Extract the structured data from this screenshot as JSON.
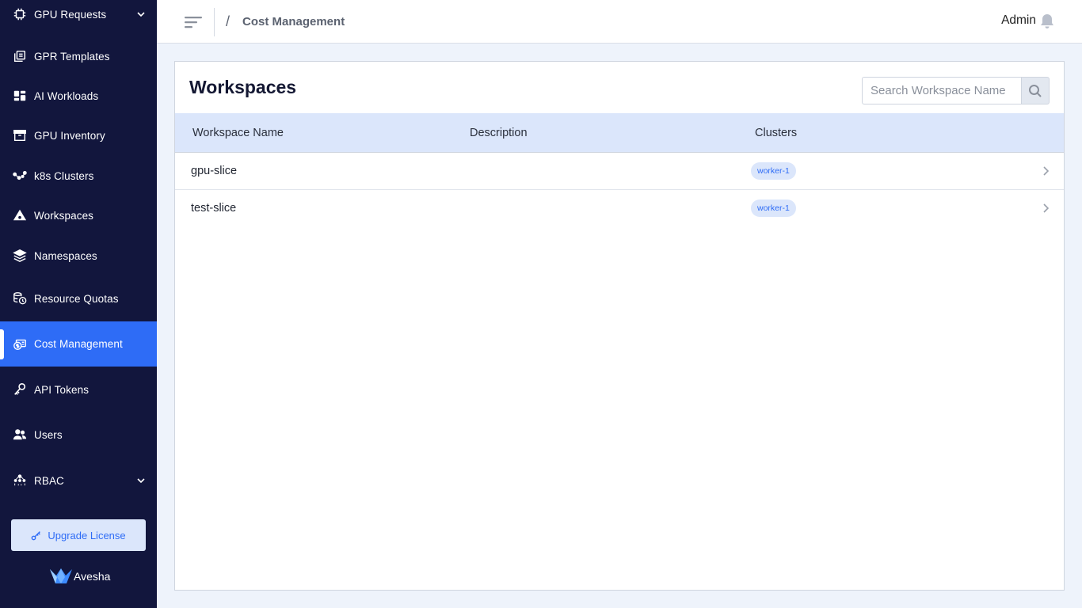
{
  "sidebar": {
    "items": [
      {
        "label": "GPU Requests",
        "icon": "chip-icon",
        "has_chevron": true
      },
      {
        "label": "GPR Templates",
        "icon": "copy-icon"
      },
      {
        "label": "AI Workloads",
        "icon": "dashboard-icon"
      },
      {
        "label": "GPU Inventory",
        "icon": "archive-icon"
      },
      {
        "label": "k8s Clusters",
        "icon": "network-icon"
      },
      {
        "label": "Workspaces",
        "icon": "pyramid-icon"
      },
      {
        "label": "Namespaces",
        "icon": "layers-icon"
      },
      {
        "label": "Resource Quotas",
        "icon": "coins-clock-icon"
      },
      {
        "label": "Cost Management",
        "icon": "money-icon",
        "active": true
      },
      {
        "label": "API Tokens",
        "icon": "key-icon"
      },
      {
        "label": "Users",
        "icon": "users-icon"
      },
      {
        "label": "RBAC",
        "icon": "org-icon",
        "has_chevron": true
      }
    ],
    "upgrade_label": "Upgrade License",
    "brand": "Avesha"
  },
  "header": {
    "separator": "/",
    "breadcrumb": "Cost Management",
    "user": "Admin"
  },
  "main": {
    "title": "Workspaces",
    "search_placeholder": "Search Workspace Name",
    "columns": [
      "Workspace Name",
      "Description",
      "Clusters"
    ],
    "rows": [
      {
        "name": "gpu-slice",
        "description": "",
        "cluster": "worker-1"
      },
      {
        "name": "test-slice",
        "description": "",
        "cluster": "worker-1"
      }
    ]
  },
  "colors": {
    "sidebar_bg": "#12163d",
    "accent": "#2e6cf6",
    "header_row_bg": "#dbe6fb",
    "page_bg": "#eef3fb"
  }
}
